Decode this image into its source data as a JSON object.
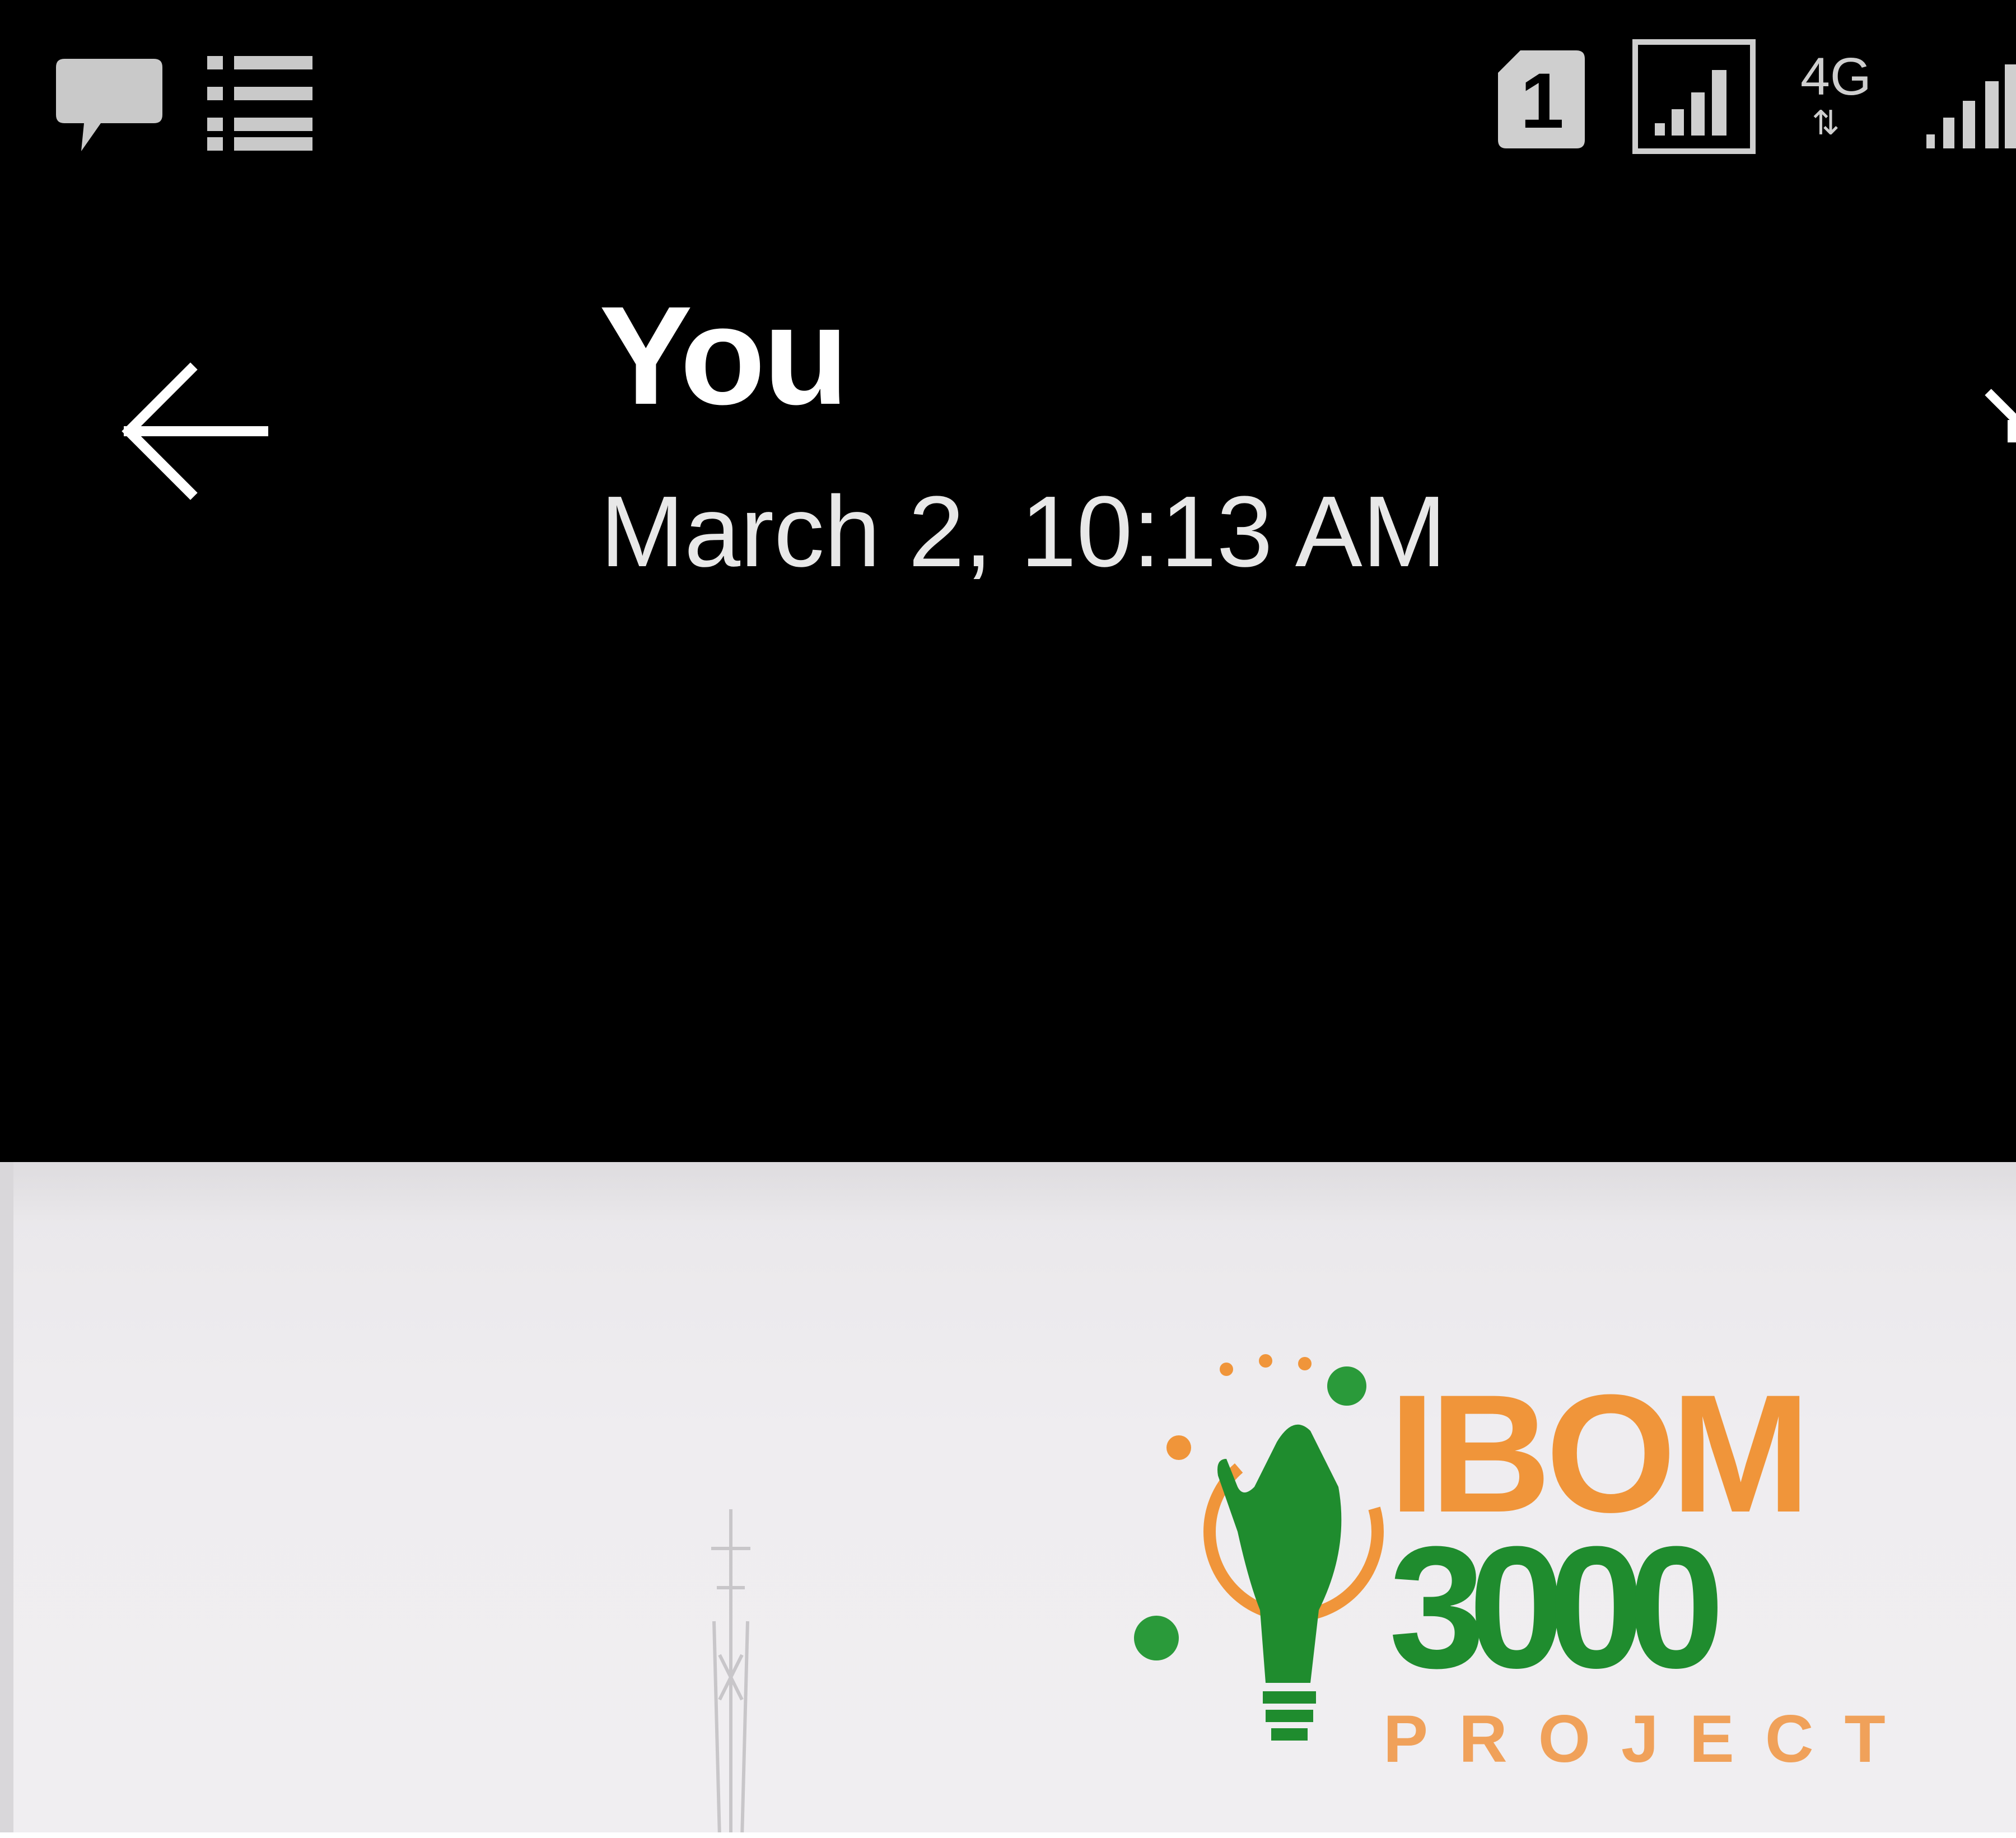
{
  "status_bar": {
    "left_icons": [
      "message-icon",
      "list-icon"
    ],
    "right_icons": [
      "sim1-icon",
      "signal-icon",
      "network-4g-icon",
      "signal-icon"
    ],
    "sim_label": "1",
    "network_label": "4G"
  },
  "header": {
    "title": "You",
    "subtitle": "March 2, 10:13 AM",
    "back_icon": "arrow-left-icon"
  },
  "media": {
    "logo": {
      "line1": "IBOM",
      "line2": "3000",
      "line3": "PROJECT"
    }
  },
  "colors": {
    "status_bar_bg": "#000000",
    "app_bar_bg": "#000000",
    "logo_orange": "#f0953a",
    "logo_green": "#1f8c2e",
    "media_bg": "#eeecef"
  }
}
